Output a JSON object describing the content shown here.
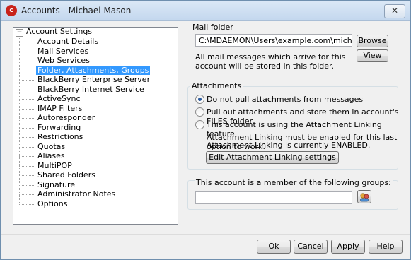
{
  "window": {
    "title": "Accounts - Michael Mason",
    "close_glyph": "✕",
    "app_icon_letter": "c"
  },
  "tree": {
    "root_label": "Account Settings",
    "expander_glyph": "−",
    "items": [
      {
        "label": "Account Details"
      },
      {
        "label": "Mail Services"
      },
      {
        "label": "Web Services"
      },
      {
        "label": "Folder, Attachments, Groups"
      },
      {
        "label": "BlackBerry Enterprise Server"
      },
      {
        "label": "BlackBerry Internet Service"
      },
      {
        "label": "ActiveSync"
      },
      {
        "label": "IMAP Filters"
      },
      {
        "label": "Autoresponder"
      },
      {
        "label": "Forwarding"
      },
      {
        "label": "Restrictions"
      },
      {
        "label": "Quotas"
      },
      {
        "label": "Aliases"
      },
      {
        "label": "MultiPOP"
      },
      {
        "label": "Shared Folders"
      },
      {
        "label": "Signature"
      },
      {
        "label": "Administrator Notes"
      },
      {
        "label": "Options"
      }
    ],
    "selected_index": 3
  },
  "mail_folder": {
    "title": "Mail folder",
    "path_value": "C:\\MDAEMON\\Users\\example.com\\michael.mason\\",
    "browse_label": "Browse",
    "view_label": "View",
    "description": "All mail messages which arrive for this account will be stored in this folder."
  },
  "attachments": {
    "title": "Attachments",
    "options": [
      {
        "label": "Do not pull attachments from messages",
        "checked": true
      },
      {
        "label": "Pull out attachments and store them in account's FILES folder",
        "checked": false
      },
      {
        "label": "This account is using the Attachment Linking feature",
        "checked": false
      }
    ],
    "note_line1": "Attachment Linking must be enabled for this last option to work.",
    "note_line2": "Attachment Linking is currently ENABLED.",
    "edit_button_label": "Edit Attachment Linking settings"
  },
  "groups": {
    "label": "This account is a member of the following groups:",
    "value": "",
    "icon": "groups-icon"
  },
  "footer": {
    "ok_label": "Ok",
    "cancel_label": "Cancel",
    "apply_label": "Apply",
    "help_label": "Help"
  }
}
